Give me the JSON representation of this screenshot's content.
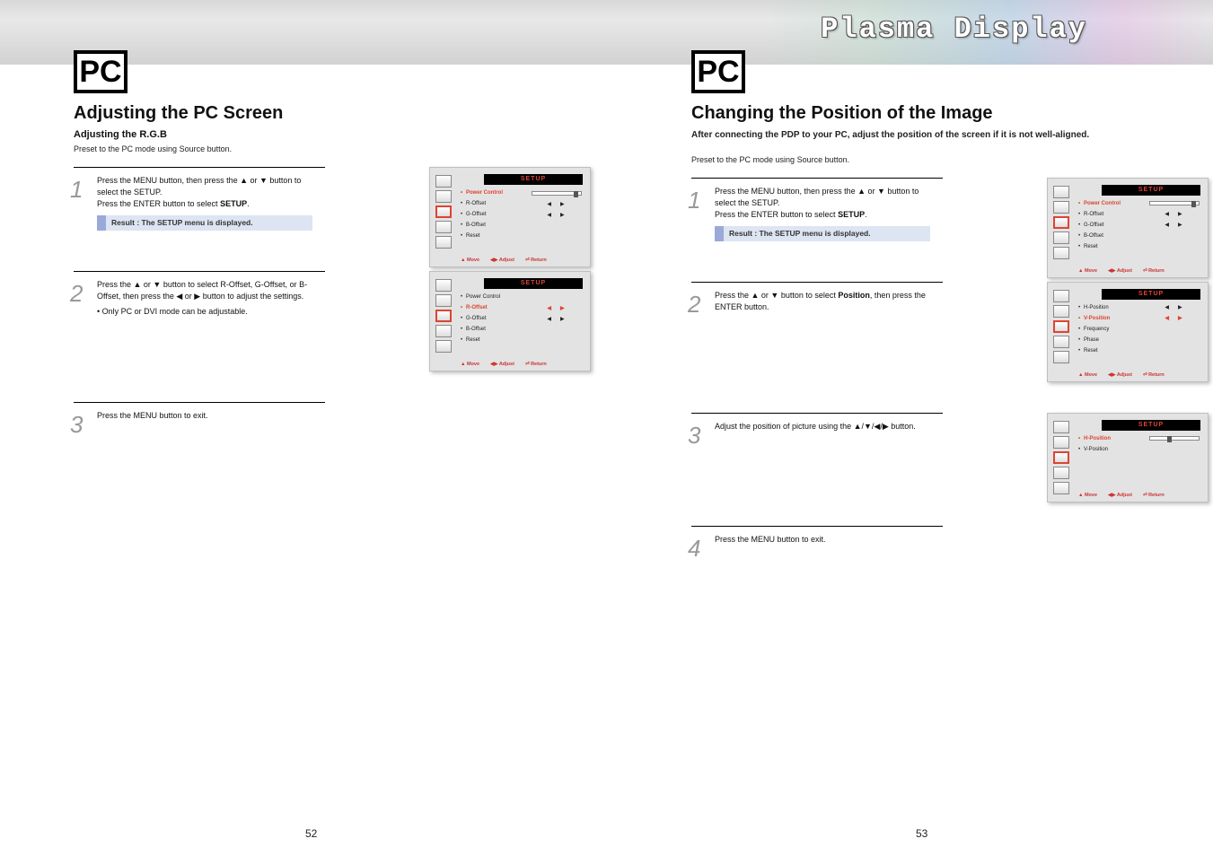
{
  "banner": {
    "title": "Plasma Display"
  },
  "pc_label": "PC",
  "left": {
    "title": "Adjusting the PC Screen",
    "subtitle": "Adjusting the R.G.B",
    "preface": "Preset to the PC mode using Source button.",
    "steps": [
      {
        "num": "1",
        "lines": [
          {
            "t": "Press the MENU button, then press the ▲ or ▼ button to select the SETUP."
          },
          {
            "t": "Press the ENTER button to select ",
            "b": "SETUP",
            "t2": "."
          }
        ],
        "result": "Result : The SETUP menu is displayed."
      },
      {
        "num": "2",
        "lines": [
          {
            "t": "Press the ▲ or ▼ button to select R-Offset, G-Offset, or B-Offset, then press the ◀ or ▶ button to adjust the settings."
          },
          {
            "t": "• Only PC or DVI mode can be adjustable."
          }
        ]
      },
      {
        "num": "3",
        "lines": [
          {
            "t": "Press the MENU button to exit."
          }
        ]
      }
    ],
    "osd": [
      {
        "header": "SETUP",
        "rows": [
          {
            "label": "Power Control",
            "slider": 85,
            "hl": true
          },
          {
            "label": "R-Offset",
            "arrows": true
          },
          {
            "label": "G-Offset",
            "arrows": true
          },
          {
            "label": "B-Offset"
          },
          {
            "label": "Reset"
          }
        ]
      },
      {
        "header": "SETUP",
        "rows": [
          {
            "label": "Power Control"
          },
          {
            "label": "R-Offset",
            "arrows": true,
            "hl": true
          },
          {
            "label": "G-Offset",
            "arrows": true
          },
          {
            "label": "B-Offset"
          },
          {
            "label": "Reset"
          }
        ]
      }
    ],
    "footer": [
      "▲ Move",
      "◀▶ Adjust",
      "⏎ Return"
    ]
  },
  "right": {
    "title": "Changing the Position of the Image",
    "subtitle": "After connecting the PDP to your PC, adjust the position of the screen if it is not well-aligned.",
    "preface": "Preset to the PC mode using Source button.",
    "steps": [
      {
        "num": "1",
        "lines": [
          {
            "t": "Press the MENU button, then press the ▲ or ▼ button to select the SETUP."
          },
          {
            "t": "Press the ENTER button to select ",
            "b": "SETUP",
            "t2": "."
          }
        ],
        "result": "Result : The SETUP menu is displayed."
      },
      {
        "num": "2",
        "lines": [
          {
            "t": "Press the ▲ or ▼ button to select ",
            "b": "Position",
            "t2": ", then press the ENTER button."
          }
        ]
      },
      {
        "num": "3",
        "lines": [
          {
            "t": "Adjust the position of picture using the ▲/▼/◀/▶ button."
          }
        ]
      },
      {
        "num": "4",
        "lines": [
          {
            "t": "Press the MENU button to exit."
          }
        ]
      }
    ],
    "osd": [
      {
        "header": "SETUP",
        "rows": [
          {
            "label": "Power Control",
            "slider": 85,
            "hl": true
          },
          {
            "label": "R-Offset",
            "arrows": true
          },
          {
            "label": "G-Offset",
            "arrows": true
          },
          {
            "label": "B-Offset"
          },
          {
            "label": "Reset"
          }
        ]
      },
      {
        "header": "SETUP",
        "rows": [
          {
            "label": "H-Position",
            "arrows": true
          },
          {
            "label": "V-Position",
            "arrows": true,
            "hl": true
          },
          {
            "label": "Frequency"
          },
          {
            "label": "Phase"
          },
          {
            "label": "Reset"
          }
        ]
      },
      {
        "header": "SETUP",
        "rows": [
          {
            "label": "H-Position",
            "slider": 35,
            "hl": true
          },
          {
            "label": "V-Position"
          }
        ]
      }
    ],
    "footer": [
      "▲ Move",
      "◀▶ Adjust",
      "⏎ Return"
    ]
  },
  "pages": {
    "left": "52",
    "right": "53"
  }
}
